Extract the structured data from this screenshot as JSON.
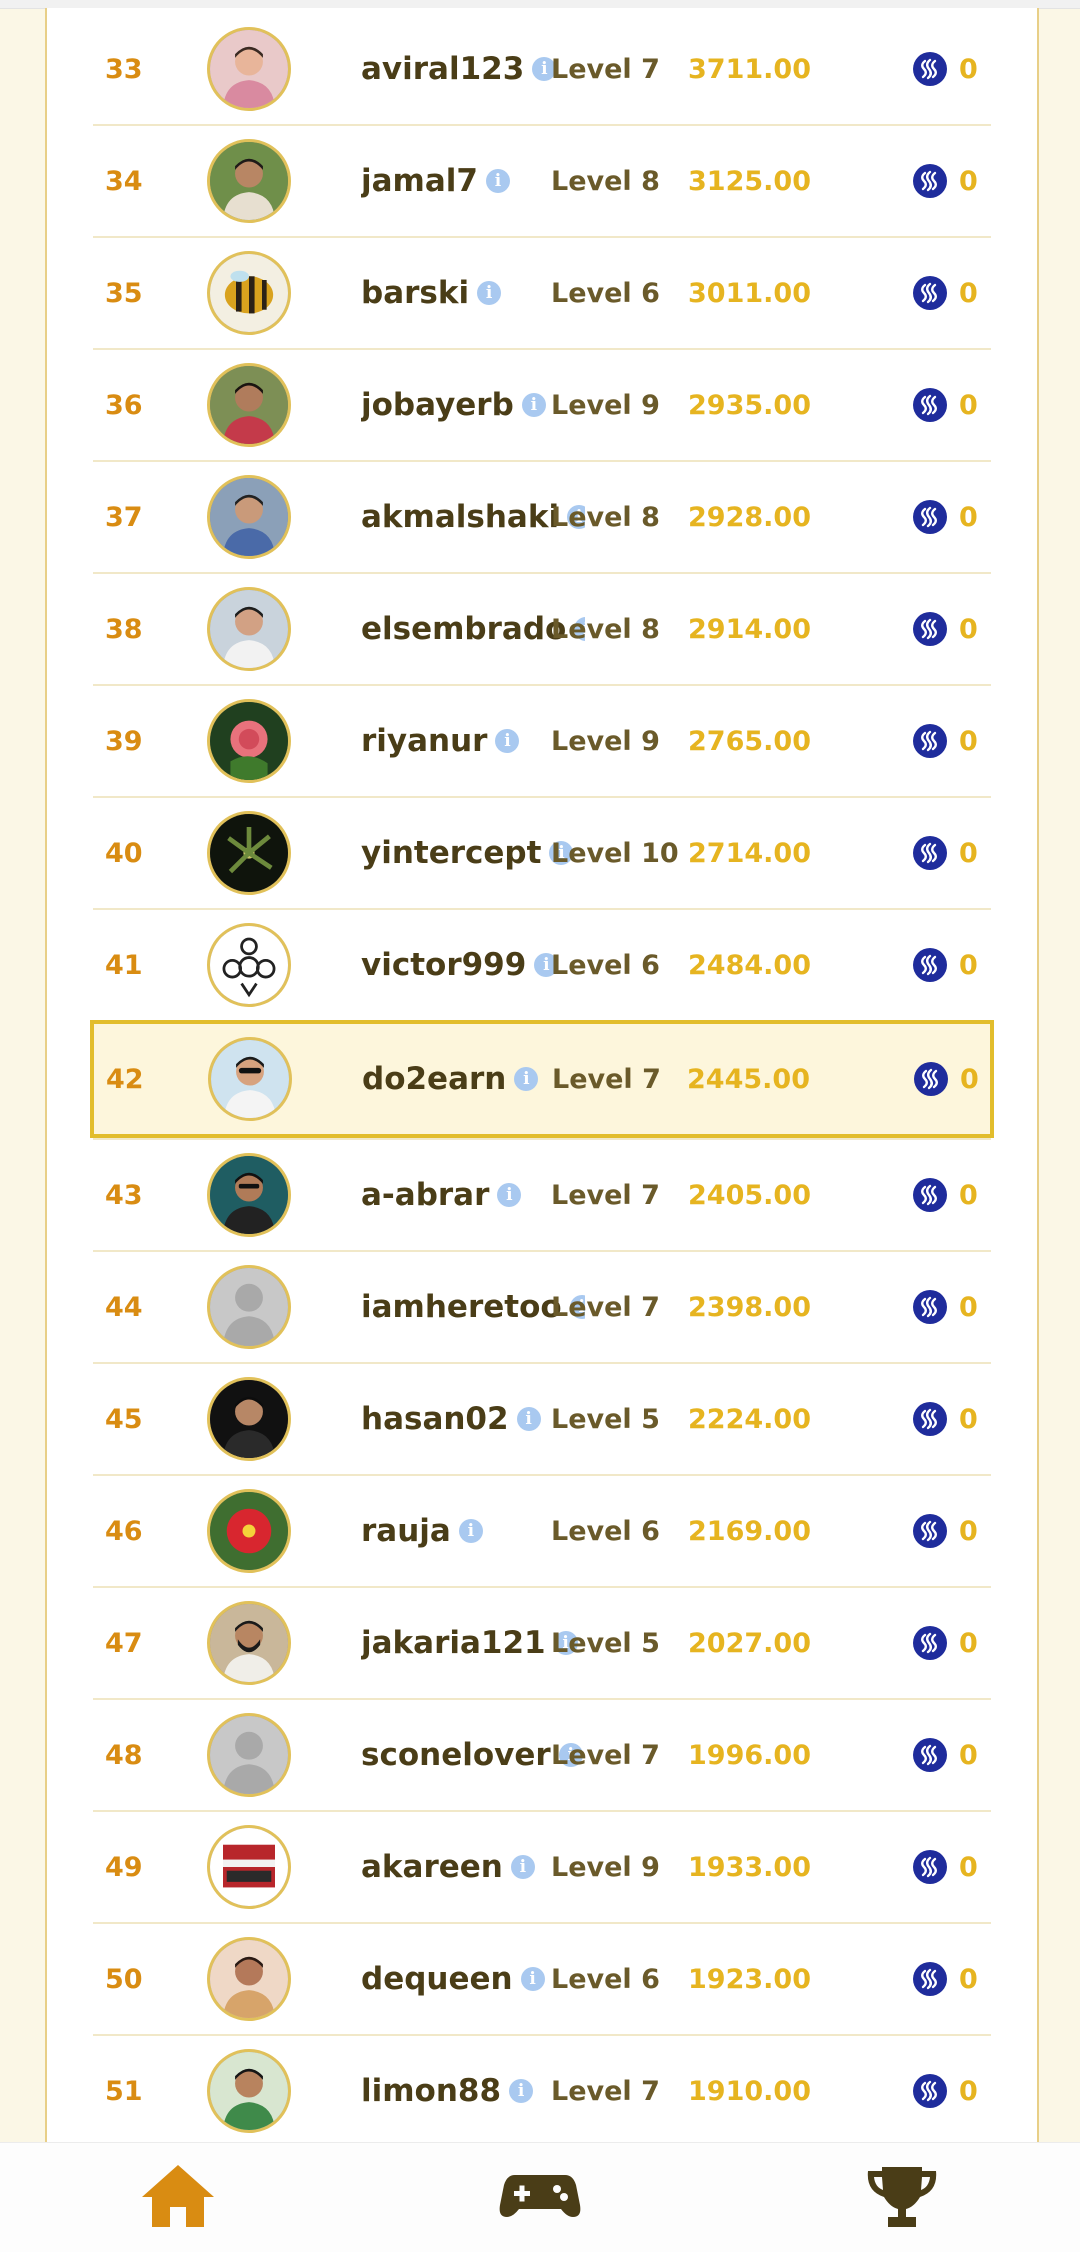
{
  "leaderboard": {
    "rows": [
      {
        "rank": "33",
        "name": "aviral123",
        "level": "Level 7",
        "score": "3711.00",
        "reward": "0",
        "avatar": "photo-girl-pink"
      },
      {
        "rank": "34",
        "name": "jamal7",
        "level": "Level 8",
        "score": "3125.00",
        "reward": "0",
        "avatar": "photo-man-child"
      },
      {
        "rank": "35",
        "name": "barski",
        "level": "Level 6",
        "score": "3011.00",
        "reward": "0",
        "avatar": "bee-ball"
      },
      {
        "rank": "36",
        "name": "jobayerb",
        "level": "Level 9",
        "score": "2935.00",
        "reward": "0",
        "avatar": "photo-man-red"
      },
      {
        "rank": "37",
        "name": "akmalshaki",
        "level": "Level 8",
        "score": "2928.00",
        "reward": "0",
        "avatar": "photo-man-car"
      },
      {
        "rank": "38",
        "name": "elsembrado",
        "level": "Level 8",
        "score": "2914.00",
        "reward": "0",
        "avatar": "photo-man-city"
      },
      {
        "rank": "39",
        "name": "riyanur",
        "level": "Level 9",
        "score": "2765.00",
        "reward": "0",
        "avatar": "rose-flower"
      },
      {
        "rank": "40",
        "name": "yintercept",
        "level": "Level 10",
        "score": "2714.00",
        "reward": "0",
        "avatar": "dark-flower"
      },
      {
        "rank": "41",
        "name": "victor999",
        "level": "Level 6",
        "score": "2484.00",
        "reward": "0",
        "avatar": "logo-bulb"
      },
      {
        "rank": "42",
        "name": "do2earn",
        "level": "Level 7",
        "score": "2445.00",
        "reward": "0",
        "avatar": "photo-man-sunglasses",
        "highlight": true
      },
      {
        "rank": "43",
        "name": "a-abrar",
        "level": "Level 7",
        "score": "2405.00",
        "reward": "0",
        "avatar": "photo-man-teal"
      },
      {
        "rank": "44",
        "name": "iamheretoo",
        "level": "Level 7",
        "score": "2398.00",
        "reward": "0",
        "avatar": "default-person"
      },
      {
        "rank": "45",
        "name": "hasan02",
        "level": "Level 5",
        "score": "2224.00",
        "reward": "0",
        "avatar": "photo-man-dark"
      },
      {
        "rank": "46",
        "name": "rauja",
        "level": "Level 6",
        "score": "2169.00",
        "reward": "0",
        "avatar": "hibiscus-flower"
      },
      {
        "rank": "47",
        "name": "jakaria121",
        "level": "Level 5",
        "score": "2027.00",
        "reward": "0",
        "avatar": "photo-man-beard"
      },
      {
        "rank": "48",
        "name": "sconelover",
        "level": "Level 7",
        "score": "1996.00",
        "reward": "0",
        "avatar": "default-person"
      },
      {
        "rank": "49",
        "name": "akareen",
        "level": "Level 9",
        "score": "1933.00",
        "reward": "0",
        "avatar": "photo-gift"
      },
      {
        "rank": "50",
        "name": "dequeen",
        "level": "Level 6",
        "score": "1923.00",
        "reward": "0",
        "avatar": "photo-woman"
      },
      {
        "rank": "51",
        "name": "limon88",
        "level": "Level 7",
        "score": "1910.00",
        "reward": "0",
        "avatar": "photo-man-green"
      }
    ]
  },
  "bottom_nav": {
    "items": [
      {
        "icon": "home-icon",
        "color": "#d98c12"
      },
      {
        "icon": "gamepad-icon",
        "color": "#4a3d17"
      },
      {
        "icon": "trophy-icon",
        "color": "#4a3d17"
      }
    ]
  },
  "colors": {
    "rank": "#d98c12",
    "name": "#4a3d17",
    "level": "#6a5a2a",
    "score": "#e6b420",
    "coin": "#1f2c9c",
    "highlight_border": "#e2bd2c",
    "info": "#a9c9f0"
  }
}
